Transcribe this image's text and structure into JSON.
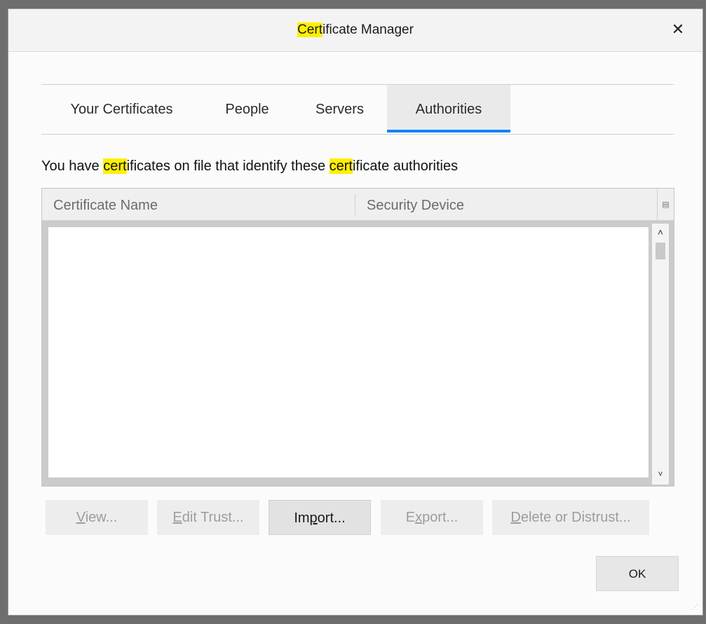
{
  "dialog": {
    "title_highlight": "Cert",
    "title_rest": "ificate Manager",
    "close_icon": "close-icon"
  },
  "tabs": [
    {
      "label": "Your Certificates",
      "active": false
    },
    {
      "label": "People",
      "active": false
    },
    {
      "label": "Servers",
      "active": false
    },
    {
      "label": "Authorities",
      "active": true
    }
  ],
  "description": {
    "part1": "You have ",
    "hl1": "cert",
    "part2": "ificates on file that identify these ",
    "hl2": "cert",
    "part3": "ificate authorities"
  },
  "tree": {
    "columns": [
      "Certificate Name",
      "Security Device"
    ],
    "column_picker_icon": "column-picker-icon",
    "rows": []
  },
  "buttons": {
    "view": {
      "mnemonic": "V",
      "rest": "iew...",
      "enabled": false
    },
    "edit_trust": {
      "mnemonic": "E",
      "rest": "dit Trust...",
      "enabled": false
    },
    "import": {
      "pre": "Im",
      "mnemonic": "p",
      "rest": "ort...",
      "enabled": true
    },
    "export": {
      "pre": "E",
      "mnemonic": "x",
      "rest": "port...",
      "enabled": false
    },
    "delete": {
      "mnemonic": "D",
      "rest": "elete or Distrust...",
      "enabled": false
    },
    "ok": "OK"
  },
  "colors": {
    "highlight": "#ffef00",
    "active_tab_underline": "#0a84ff"
  }
}
